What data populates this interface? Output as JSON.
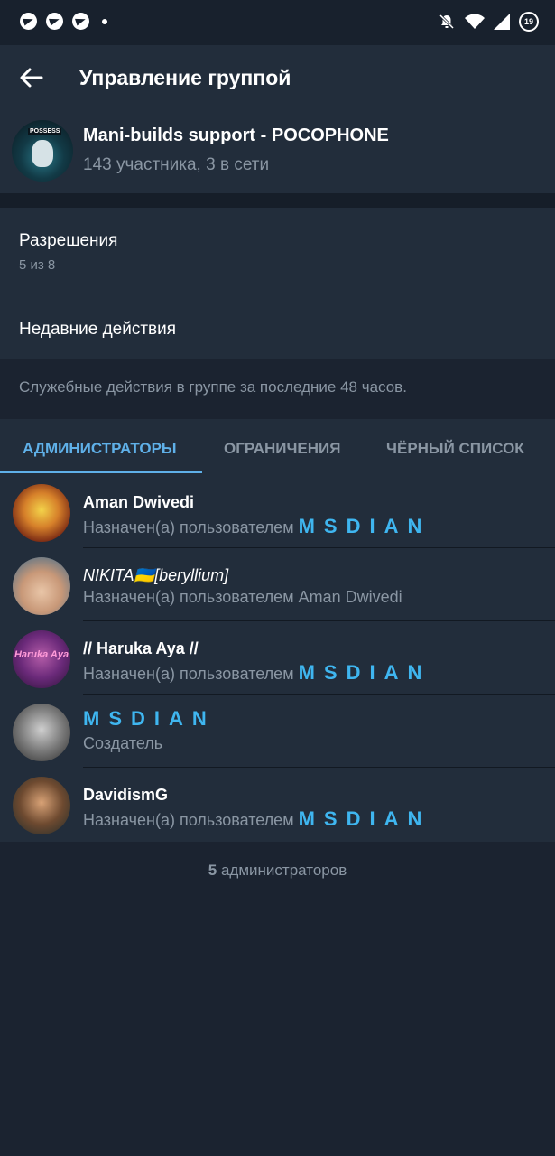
{
  "status_bar": {
    "notification_icons": [
      "telegram-icon",
      "telegram-icon",
      "telegram-icon"
    ],
    "battery_level": "19"
  },
  "header": {
    "title": "Управление группой"
  },
  "group": {
    "name": "Mani-builds support - POCOPHONE",
    "subtitle": "143 участника, 3 в сети",
    "avatar_banner": "POSSESS"
  },
  "settings": {
    "permissions_title": "Разрешения",
    "permissions_sub": "5 из 8",
    "recent_actions_title": "Недавние действия",
    "recent_actions_hint": "Служебные действия в группе за последние 48 часов."
  },
  "tabs": [
    {
      "label": "АДМИНИСТРАТОРЫ",
      "active": true
    },
    {
      "label": "ОГРАНИЧЕНИЯ",
      "active": false
    },
    {
      "label": "ЧЁРНЫЙ СПИСОК",
      "active": false
    }
  ],
  "admins": [
    {
      "name": "Aman Dwivedi",
      "sub_prefix": "Назначен(а) пользователем",
      "sub_highlight": "MSDIAN"
    },
    {
      "name": "NIKITA🇺🇦[beryllium]",
      "sub_prefix": "Назначен(а) пользователем Aman Dwivedi",
      "sub_highlight": ""
    },
    {
      "name": "// Haruka Aya //",
      "sub_prefix": "Назначен(а) пользователем",
      "sub_highlight": "MSDIAN",
      "avatar_text": "Haruka Aya"
    },
    {
      "name": "MSDIAN",
      "sub_prefix": "Создатель",
      "sub_highlight": ""
    },
    {
      "name": "DavidismG",
      "sub_prefix": "Назначен(а) пользователем",
      "sub_highlight": "MSDIAN"
    }
  ],
  "footer": {
    "count": "5",
    "label": "администраторов"
  },
  "colors": {
    "accent": "#5fb0e8",
    "highlight": "#3fb6f0",
    "background": "#1b2330",
    "surface": "#222d3b"
  }
}
